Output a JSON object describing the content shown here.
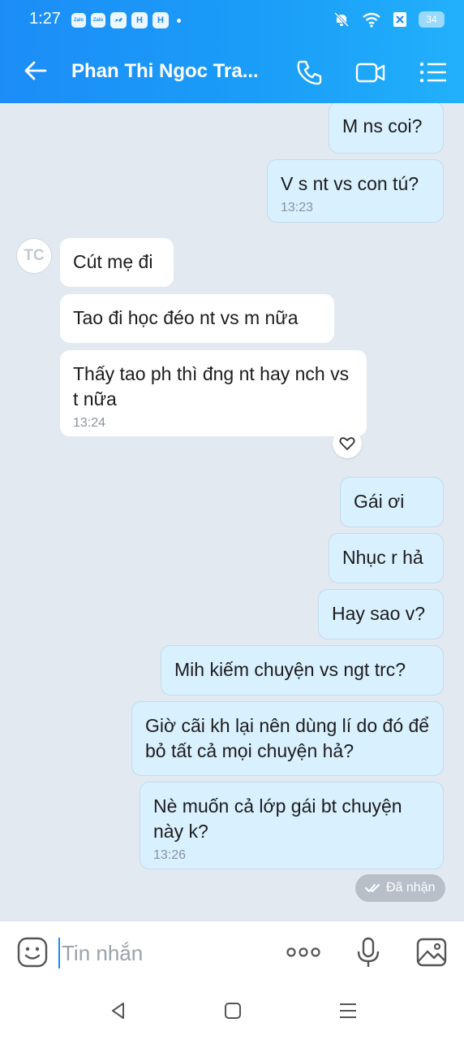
{
  "status_bar": {
    "time": "1:27",
    "battery": "34"
  },
  "header": {
    "contact_name": "Phan Thi Ngoc Tra..."
  },
  "avatar": {
    "initials": "TC"
  },
  "messages": [
    {
      "text": "M ns coi?"
    },
    {
      "text": "V s nt vs con tú?",
      "time": "13:23"
    },
    {
      "text": "Cút mẹ đi"
    },
    {
      "text": "Tao đi học đéo nt vs m nữa"
    },
    {
      "text": "Thấy tao ph thì đng nt hay nch vs t nữa",
      "time": "13:24"
    },
    {
      "text": "Gái ơi"
    },
    {
      "text": "Nhục r hả"
    },
    {
      "text": "Hay sao v?"
    },
    {
      "text": "Mih kiếm chuyện vs ngt trc?"
    },
    {
      "text": "Giờ cãi kh lại nên dùng lí do đó để bỏ tất cả mọi chuyện hả?"
    },
    {
      "text": "Nè muốn cả lớp gái bt chuyện này k?",
      "time": "13:26"
    }
  ],
  "read_status": "Đã nhận",
  "input": {
    "placeholder": "Tin nhắn"
  },
  "colors": {
    "header": "#1c8df7",
    "my_bubble": "#d9f0ff",
    "their_bubble": "#ffffff",
    "background": "#e2e9f1"
  }
}
